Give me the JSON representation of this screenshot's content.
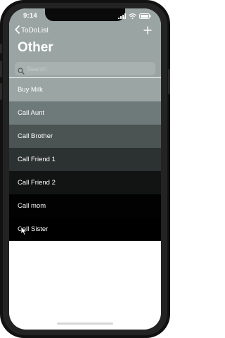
{
  "status_bar": {
    "time": "9:14"
  },
  "nav": {
    "back_label": "ToDoList",
    "title": "Other"
  },
  "search": {
    "placeholder": "Search"
  },
  "items": [
    {
      "label": "Buy Milk",
      "color": "#9aa5a4"
    },
    {
      "label": "Call Aunt",
      "color": "#6e7a79"
    },
    {
      "label": "Call Brother",
      "color": "#4b5453"
    },
    {
      "label": "Call Friend 1",
      "color": "#2c3131"
    },
    {
      "label": "Call Friend 2",
      "color": "#121414"
    },
    {
      "label": "Call mom",
      "color": "#020202"
    },
    {
      "label": "Call Sister",
      "color": "#000000"
    }
  ],
  "colors": {
    "header_background": "#9aa4a3",
    "text": "#ffffff",
    "screen_background": "#ffffff"
  },
  "icons": [
    "wifi-icon",
    "cellular-icon",
    "battery-icon",
    "chevron-left-icon",
    "plus-icon",
    "search-icon",
    "cursor-icon"
  ]
}
